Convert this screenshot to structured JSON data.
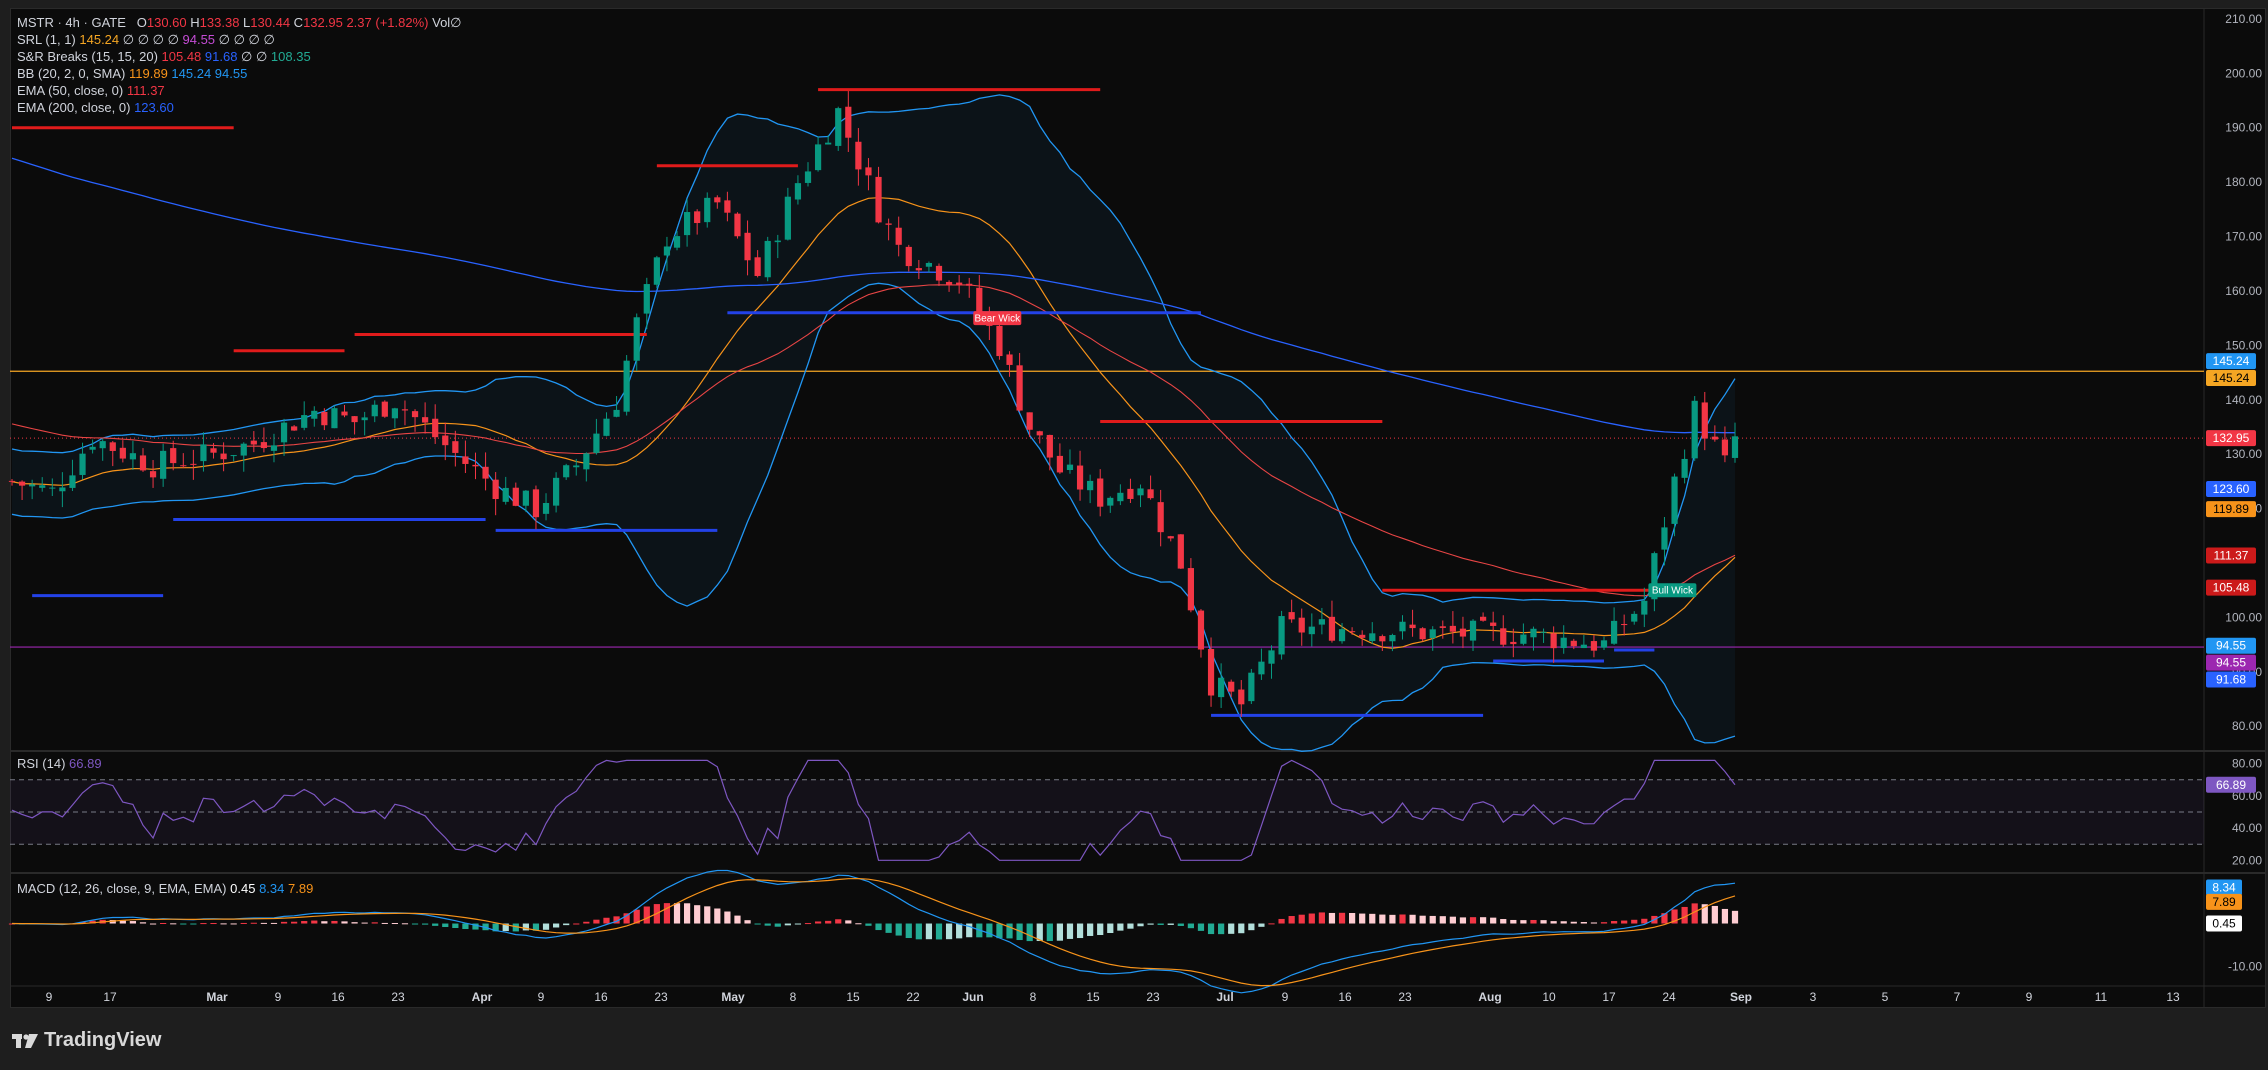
{
  "header": {
    "symbol": "MSTR",
    "interval": "4h",
    "exchange": "GATE",
    "o_label": "O",
    "o": "130.60",
    "h_label": "H",
    "h": "133.38",
    "l_label": "L",
    "l": "130.44",
    "c_label": "C",
    "c": "132.95",
    "change": "2.37 (+1.82%)",
    "vol": "Vol∅"
  },
  "indicators": [
    {
      "name": "SRL (1, 1)",
      "values": [
        "145.24",
        "∅",
        "∅",
        "∅",
        "∅",
        "94.55",
        "∅",
        "∅",
        "∅",
        "∅"
      ],
      "colors": [
        "#f5a623",
        "#d1d4dc",
        "#d1d4dc",
        "#d1d4dc",
        "#d1d4dc",
        "#c54cd6",
        "#d1d4dc",
        "#d1d4dc",
        "#d1d4dc",
        "#d1d4dc"
      ]
    },
    {
      "name": "S&R Breaks (15, 15, 20)",
      "values": [
        "105.48",
        "91.68",
        "∅",
        "∅",
        "108.35"
      ],
      "colors": [
        "#f23645",
        "#2962ff",
        "#d1d4dc",
        "#d1d4dc",
        "#22ab94"
      ]
    },
    {
      "name": "BB (20, 2, 0, SMA)",
      "values": [
        "119.89",
        "145.24",
        "94.55"
      ],
      "colors": [
        "#f7931a",
        "#2196f3",
        "#2196f3"
      ]
    },
    {
      "name": "EMA (50, close, 0)",
      "values": [
        "111.37"
      ],
      "colors": [
        "#f23645"
      ]
    },
    {
      "name": "EMA (200, close, 0)",
      "values": [
        "123.60"
      ],
      "colors": [
        "#2962ff"
      ]
    }
  ],
  "rsi_legend": {
    "name": "RSI (14)",
    "value": "66.89"
  },
  "macd_legend": {
    "name": "MACD (12, 26, close, 9, EMA, EMA)",
    "v1": "0.45",
    "v2": "8.34",
    "v3": "7.89"
  },
  "chart_data": {
    "type": "candlestick",
    "symbol": "MSTR",
    "interval": "4h",
    "price_axis": {
      "ticks": [
        "210.00",
        "200.00",
        "190.00",
        "180.00",
        "170.00",
        "160.00",
        "150.00",
        "140.00",
        "130.00",
        "120.00",
        "100.00",
        "90.00",
        "80.00"
      ],
      "range": [
        76,
        212
      ]
    },
    "time_axis": {
      "ticks": [
        "9",
        "17",
        "Mar",
        "9",
        "16",
        "23",
        "Apr",
        "9",
        "16",
        "23",
        "May",
        "8",
        "15",
        "22",
        "Jun",
        "8",
        "15",
        "23",
        "Jul",
        "9",
        "16",
        "23",
        "Aug",
        "10",
        "17",
        "24",
        "Sep",
        "3",
        "5",
        "7",
        "9",
        "11",
        "13"
      ]
    },
    "last_close": 132.95,
    "horizontal_lines": [
      {
        "price": 145.24,
        "color": "#f5a623"
      },
      {
        "price": 94.55,
        "color": "#9c27b0"
      }
    ],
    "price_labels": [
      {
        "text": "145.24",
        "price": 147.1,
        "bg": "#2196f3",
        "fg": "#ffffff"
      },
      {
        "text": "145.24",
        "price": 144.0,
        "bg": "#f5a623",
        "fg": "#000000"
      },
      {
        "text": "132.95",
        "price": 132.95,
        "bg": "#f23645",
        "fg": "#ffffff"
      },
      {
        "text": "123.60",
        "price": 123.6,
        "bg": "#2962ff",
        "fg": "#ffffff"
      },
      {
        "text": "119.89",
        "price": 119.89,
        "bg": "#f7931a",
        "fg": "#000000"
      },
      {
        "text": "111.37",
        "price": 111.37,
        "bg": "#cc1a1a",
        "fg": "#ffffff"
      },
      {
        "text": "105.48",
        "price": 105.48,
        "bg": "#cc1a1a",
        "fg": "#ffffff"
      },
      {
        "text": "94.55",
        "price": 94.8,
        "bg": "#2196f3",
        "fg": "#ffffff"
      },
      {
        "text": "94.55",
        "price": 91.7,
        "bg": "#9c27b0",
        "fg": "#ffffff"
      },
      {
        "text": "91.68",
        "price": 88.6,
        "bg": "#2962ff",
        "fg": "#ffffff"
      }
    ],
    "resistance_breaks": [
      {
        "t0": 0,
        "t1": 22,
        "price": 190
      },
      {
        "t0": 22,
        "t1": 33,
        "price": 149
      },
      {
        "t0": 34,
        "t1": 63,
        "price": 152
      },
      {
        "t0": 64,
        "t1": 78,
        "price": 183
      },
      {
        "t0": 80,
        "t1": 108,
        "price": 197
      },
      {
        "t0": 108,
        "t1": 136,
        "price": 136
      },
      {
        "t0": 136,
        "t1": 152,
        "price": 105
      },
      {
        "t0": 152,
        "t1": 163,
        "price": 105
      }
    ],
    "support_breaks": [
      {
        "t0": 2,
        "t1": 15,
        "price": 104
      },
      {
        "t0": 16,
        "t1": 47,
        "price": 118
      },
      {
        "t0": 48,
        "t1": 70,
        "price": 116
      },
      {
        "t0": 71,
        "t1": 118,
        "price": 156
      },
      {
        "t0": 119,
        "t1": 146,
        "price": 82
      },
      {
        "t0": 147,
        "t1": 158,
        "price": 92
      },
      {
        "t0": 159,
        "t1": 163,
        "price": 94
      }
    ],
    "annotations": [
      {
        "text": "Bear Wick",
        "t": 96,
        "price": 155,
        "bg": "#f23645"
      },
      {
        "text": "Bull Wick",
        "t": 163,
        "price": 105,
        "bg": "#089981"
      }
    ],
    "rsi": {
      "ticks": [
        "80.00",
        "60.00",
        "40.00",
        "20.00"
      ],
      "range": [
        14,
        86
      ],
      "levels": [
        70,
        50,
        30
      ],
      "last": 66.89
    },
    "macd": {
      "ticks": [
        "-10.00"
      ],
      "range": [
        -14,
        11
      ],
      "macd": 8.34,
      "signal": 7.89,
      "histogram": 0.45
    }
  }
}
